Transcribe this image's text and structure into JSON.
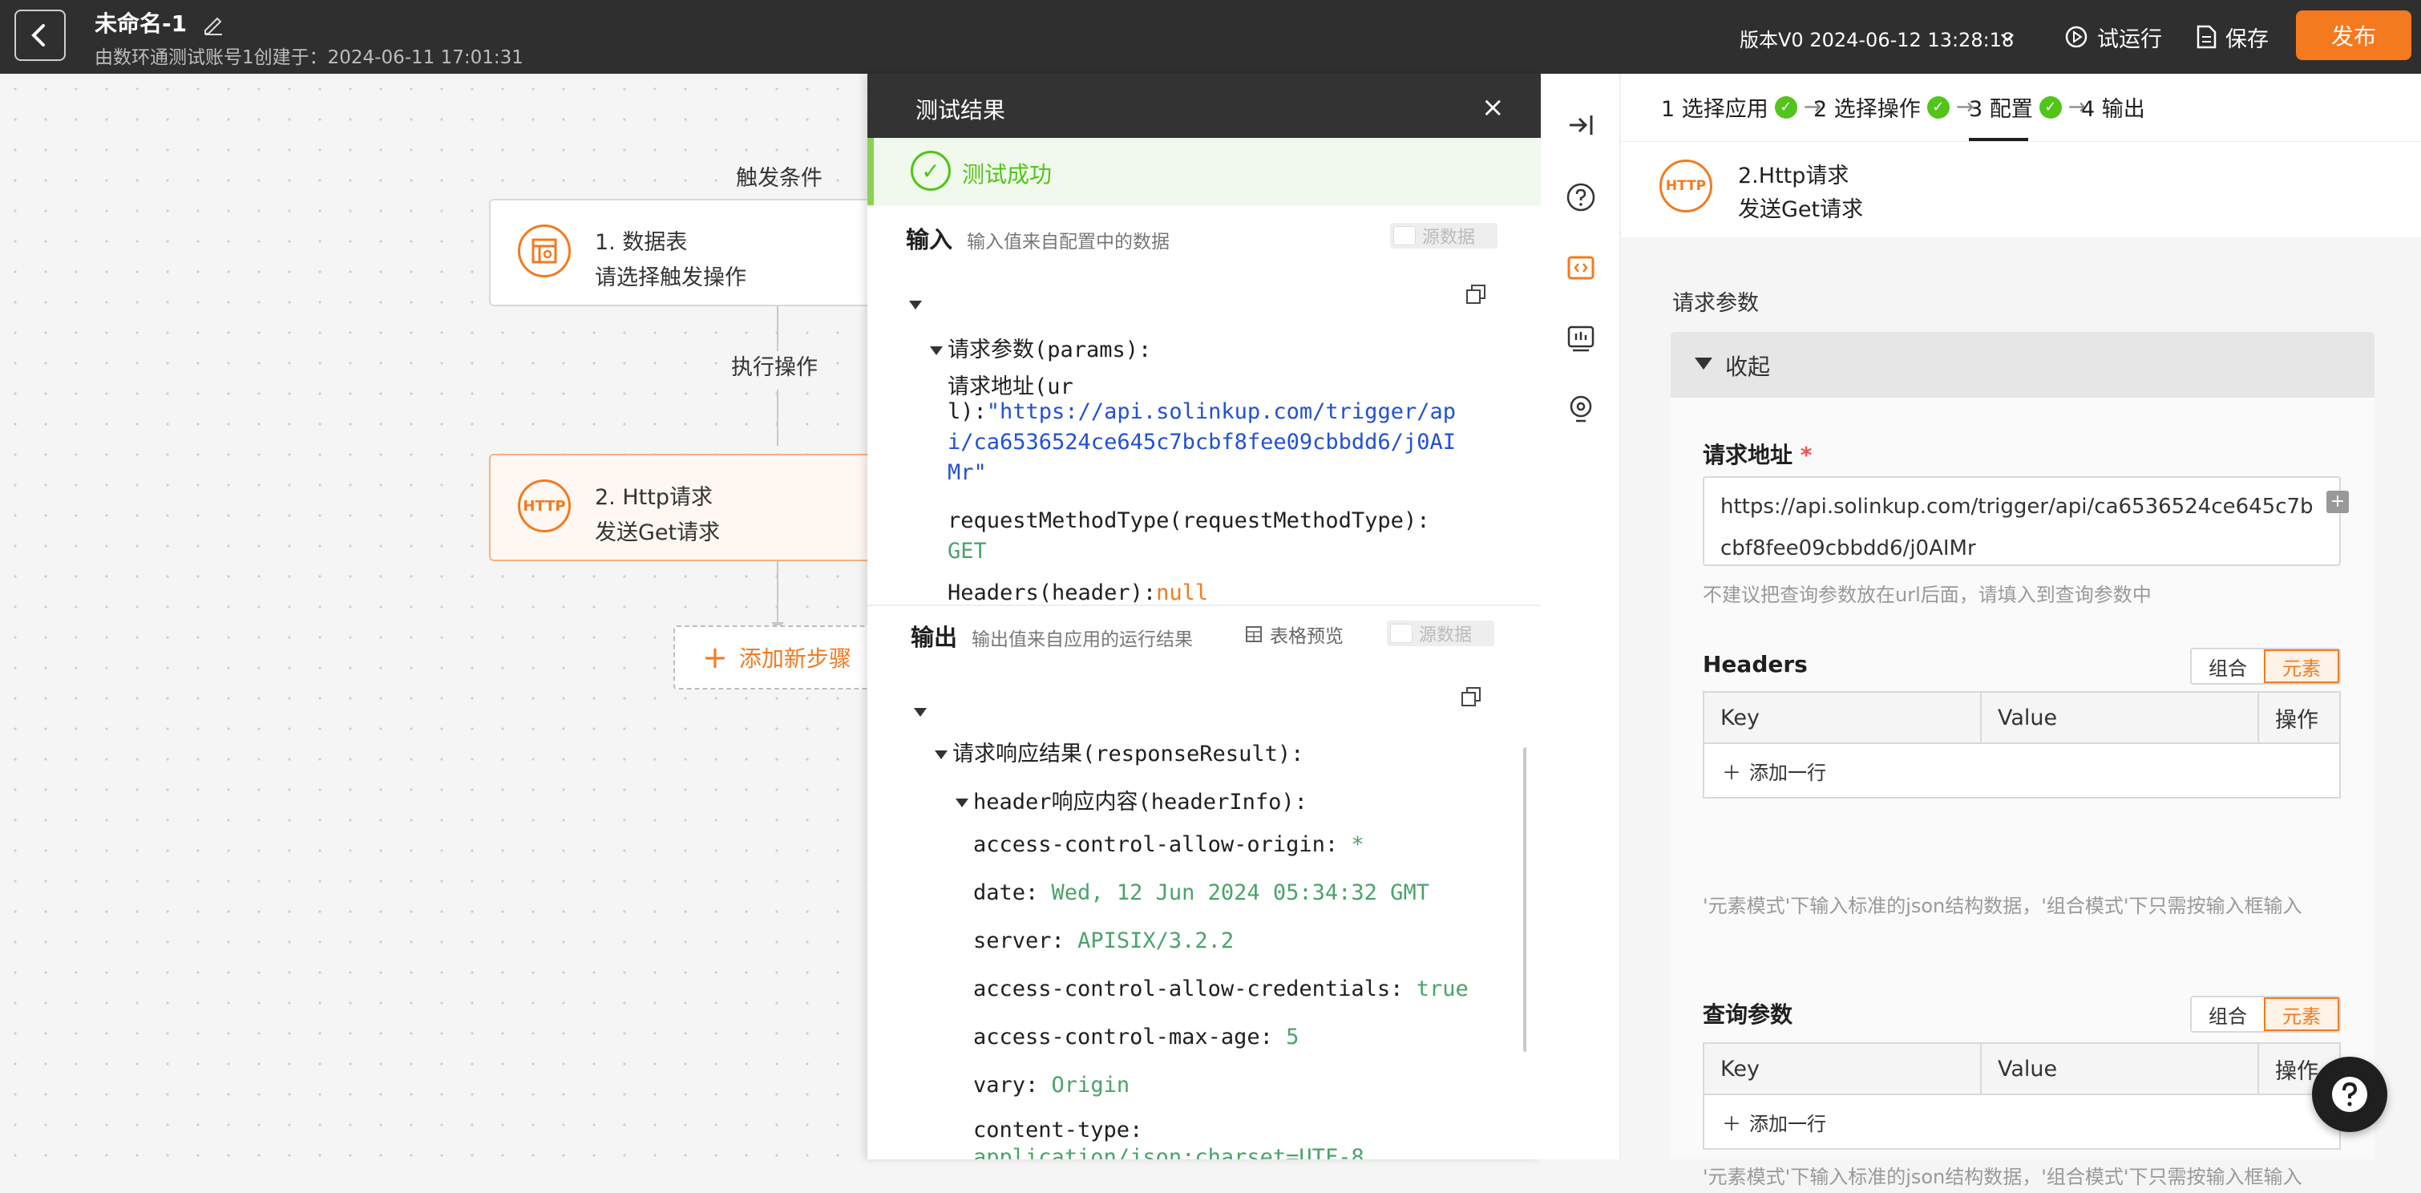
{
  "topbar": {
    "title": "未命名-1",
    "subtitle": "由数环通测试账号1创建于：2024-06-11 17:01:31",
    "version": "版本V0 2024-06-12 13:28:18",
    "run_label": "试运行",
    "save_label": "保存",
    "publish_label": "发布"
  },
  "canvas": {
    "trigger_label": "触发条件",
    "action_label": "执行操作",
    "node1": {
      "title": "1. 数据表",
      "sub": "请选择触发操作"
    },
    "node2": {
      "icon_text": "HTTP",
      "title": "2. Http请求",
      "sub": "发送Get请求"
    },
    "add_step_label": "添加新步骤"
  },
  "test_panel": {
    "title": "测试结果",
    "success": "测试成功",
    "input_title": "输入",
    "input_hint": "输入值来自配置中的数据",
    "raw_label": "源数据",
    "output_title": "输出",
    "output_hint": "输出值来自应用的运行结果",
    "table_preview": "表格预览",
    "input_tree": {
      "params_key": "请求参数(params):",
      "url_key_1": "请求地址(ur",
      "url_key_2": "l):",
      "url_val_1": "\"https://api.solinkup.com/trigger/ap",
      "url_val_2": "i/ca6536524ce645c7bcbf8fee09cbbdd6/j0AI",
      "url_val_3": "Mr\"",
      "method_key": "requestMethodType(requestMethodType):",
      "method_val": "GET",
      "headers_key": "Headers(header):",
      "headers_val": "null"
    },
    "output_tree": {
      "result_key": "请求响应结果(responseResult):",
      "header_key": "header响应内容(headerInfo):",
      "rows": [
        {
          "k": "access-control-allow-origin:",
          "v": "*"
        },
        {
          "k": "date:",
          "v": "Wed, 12 Jun 2024 05:34:32 GMT"
        },
        {
          "k": "server:",
          "v": "APISIX/3.2.2"
        },
        {
          "k": "access-control-allow-credentials:",
          "v": "true"
        },
        {
          "k": "access-control-max-age:",
          "v": "5"
        },
        {
          "k": "vary:",
          "v": "Origin"
        },
        {
          "k": "content-type:",
          "v": "application/json;charset=UTF-8"
        }
      ]
    }
  },
  "config": {
    "steps": [
      {
        "label": "1 选择应用",
        "done": true
      },
      {
        "label": "2 选择操作",
        "done": true
      },
      {
        "label": "3 配置",
        "done": true
      },
      {
        "label": "4 输出",
        "done": false
      }
    ],
    "node_icon_text": "HTTP",
    "node_title": "2.Http请求",
    "node_sub": "发送Get请求",
    "request_params_label": "请求参数",
    "collapse_label": "收起",
    "url_label": "请求地址",
    "url_value": "https://api.solinkup.com/trigger/api/ca6536524ce645c7bcbf8fee09cbbdd6/j0AIMr",
    "url_hint": "不建议把查询参数放在url后面，请填入到查询参数中",
    "headers_label": "Headers",
    "query_label": "查询参数",
    "seg_combo": "组合",
    "seg_element": "元素",
    "col_key": "Key",
    "col_value": "Value",
    "col_ops": "操作",
    "add_row": "添加一行",
    "mode_hint": "'元素模式'下输入标准的json结构数据，'组合模式'下只需按输入框输入"
  }
}
